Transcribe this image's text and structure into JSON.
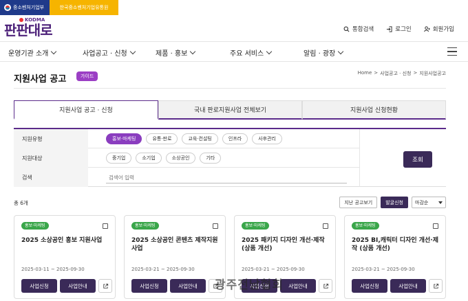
{
  "topbar": {
    "gov_label": "중소벤처기업부",
    "kodma_label": "한국중소벤처기업유통원"
  },
  "logo": {
    "brand": "KODMA",
    "text": "판판대로"
  },
  "util": {
    "search": "통합검색",
    "login": "로그인",
    "join": "회원가입"
  },
  "gnb": [
    {
      "label": "운영기관 소개"
    },
    {
      "label": "사업공고 · 신청"
    },
    {
      "label": "제품 · 홍보"
    },
    {
      "label": "주요 서비스"
    },
    {
      "label": "알림 · 광장"
    }
  ],
  "page": {
    "title": "지원사업 공고",
    "guide": "가이드"
  },
  "breadcrumb": {
    "home": "Home",
    "sep": ">",
    "level1": "사업공고 · 신청",
    "level2": "지원사업공고"
  },
  "tabs": [
    {
      "label": "지원사업 공고 · 신청"
    },
    {
      "label": "국내 판로지원사업 전체보기"
    },
    {
      "label": "지원사업 신청현황"
    }
  ],
  "filter": {
    "type": {
      "label": "지원유형",
      "options": [
        "홍보·마케팅",
        "유통·판로",
        "교육·컨설팅",
        "인프라",
        "사후관리"
      ]
    },
    "target": {
      "label": "지원대상",
      "options": [
        "중기업",
        "소기업",
        "소상공인",
        "기타"
      ]
    },
    "search": {
      "label": "검색",
      "placeholder": "검색어 입력"
    },
    "submit": "조회"
  },
  "list": {
    "total": "총 6개",
    "past": "지난 공고보기",
    "applying": "발굴신청",
    "sort": "마감순"
  },
  "cards": [
    {
      "badge": "홍보·마케팅",
      "title": "2025 소상공인 홍보 지원사업",
      "date": "2025-03-11 ~ 2025-09-30",
      "apply": "사업신청",
      "info": "사업안내"
    },
    {
      "badge": "홍보·마케팅",
      "title": "2025 소상공인 콘텐츠 제작지원사업",
      "date": "2025-03-21 ~ 2025-09-30",
      "apply": "사업신청",
      "info": "사업안내"
    },
    {
      "badge": "홍보·마케팅",
      "title": "2025 패키지 디자인 개선·제작 (상품 개선)",
      "date": "2025-03-21 ~ 2025-09-30",
      "apply": "사업신청",
      "info": "사업안내"
    },
    {
      "badge": "홍보·마케팅",
      "title": "2025 BI,캐릭터 디자인 개선·제작 (상품 개선)",
      "date": "2025-03-21 ~ 2025-09-30",
      "apply": "사업신청",
      "info": "사업안내"
    }
  ],
  "watermark": "광주전남협회",
  "colors": {
    "primary": "#5a2a8a",
    "accent": "#8a3dbf",
    "badge_green": "#3aa64a",
    "button_dark": "#3a2a58",
    "gov_blue": "#1f3a8a",
    "kodma_yellow": "#f6b400"
  }
}
